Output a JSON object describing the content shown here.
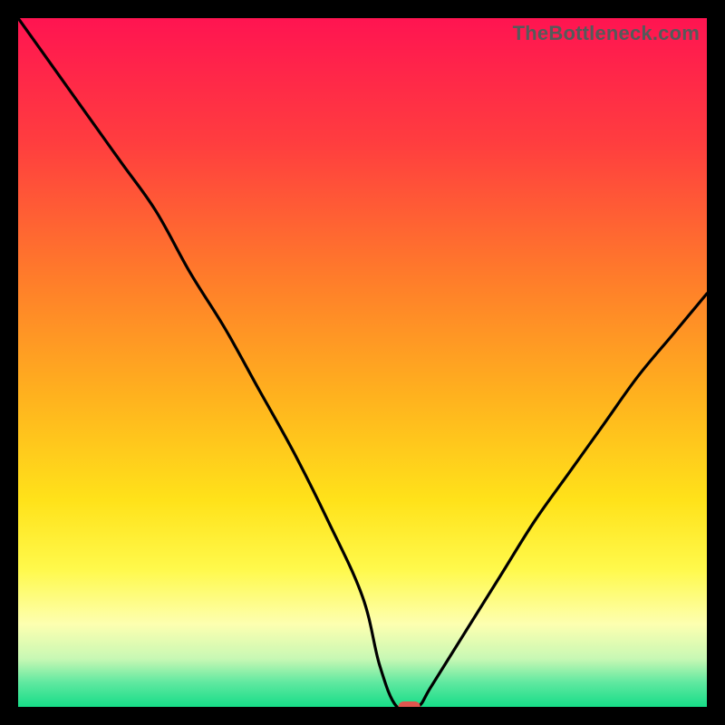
{
  "watermark": "TheBottleneck.com",
  "marker_color": "#e0554e",
  "chart_data": {
    "type": "line",
    "title": "",
    "xlabel": "",
    "ylabel": "",
    "x": [
      0.0,
      0.05,
      0.1,
      0.15,
      0.2,
      0.25,
      0.3,
      0.35,
      0.4,
      0.45,
      0.5,
      0.525,
      0.55,
      0.58,
      0.6,
      0.65,
      0.7,
      0.75,
      0.8,
      0.85,
      0.9,
      0.95,
      1.0
    ],
    "values": [
      1.0,
      0.93,
      0.86,
      0.79,
      0.72,
      0.63,
      0.55,
      0.46,
      0.37,
      0.27,
      0.16,
      0.06,
      0.0,
      0.0,
      0.03,
      0.11,
      0.19,
      0.27,
      0.34,
      0.41,
      0.48,
      0.54,
      0.6
    ],
    "flat_bottom_range": [
      0.525,
      0.58
    ],
    "marker": {
      "x_start": 0.552,
      "x_end": 0.584,
      "y": 0.0
    },
    "xlim": [
      0,
      1
    ],
    "ylim": [
      0,
      1
    ],
    "gradient_stops": [
      {
        "pos": 0.0,
        "color": "#ff1451"
      },
      {
        "pos": 0.18,
        "color": "#ff3d3f"
      },
      {
        "pos": 0.38,
        "color": "#ff7d2a"
      },
      {
        "pos": 0.55,
        "color": "#ffb21e"
      },
      {
        "pos": 0.7,
        "color": "#ffe21a"
      },
      {
        "pos": 0.8,
        "color": "#fff94b"
      },
      {
        "pos": 0.88,
        "color": "#fdffb0"
      },
      {
        "pos": 0.93,
        "color": "#c8f8b4"
      },
      {
        "pos": 0.965,
        "color": "#5fe8a0"
      },
      {
        "pos": 1.0,
        "color": "#17dd88"
      }
    ]
  }
}
